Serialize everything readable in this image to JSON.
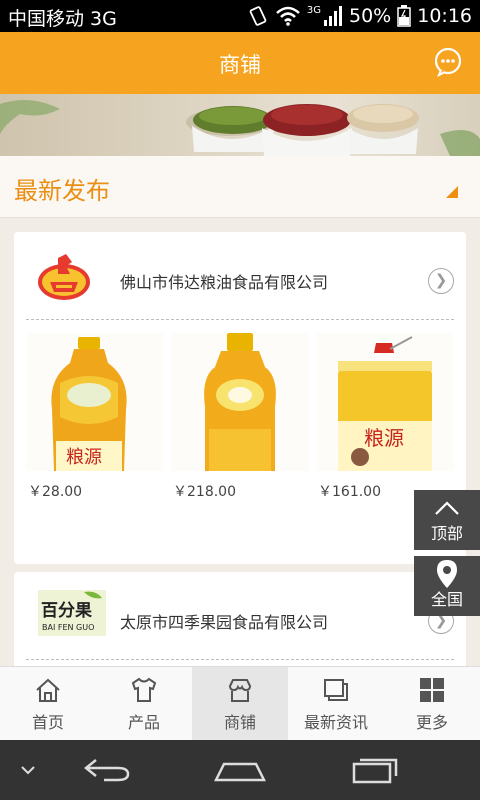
{
  "status": {
    "carrier": "中国移动 3G",
    "network": "3G",
    "battery": "50%",
    "time": "10:16"
  },
  "header": {
    "title": "商铺",
    "chat_icon": "chat-bubble-icon"
  },
  "section": {
    "title": "最新发布"
  },
  "shops": [
    {
      "name": "佛山市伟达粮油食品有限公司",
      "products": [
        {
          "price": "￥28.00"
        },
        {
          "price": "￥218.00"
        },
        {
          "price": "￥161.00"
        }
      ]
    },
    {
      "name": "太原市四季果园食品有限公司",
      "logo_text": "百分果",
      "logo_sub": "BAI FEN GUO"
    }
  ],
  "side_buttons": {
    "top_label": "顶部",
    "region_label": "全国"
  },
  "tabs": [
    {
      "label": "首页",
      "icon": "home-icon"
    },
    {
      "label": "产品",
      "icon": "shirt-icon"
    },
    {
      "label": "商铺",
      "icon": "shop-icon",
      "active": true
    },
    {
      "label": "最新资讯",
      "icon": "news-icon"
    },
    {
      "label": "更多",
      "icon": "grid-icon"
    }
  ],
  "colors": {
    "accent": "#f6a320",
    "section_title": "#ea8f13"
  }
}
